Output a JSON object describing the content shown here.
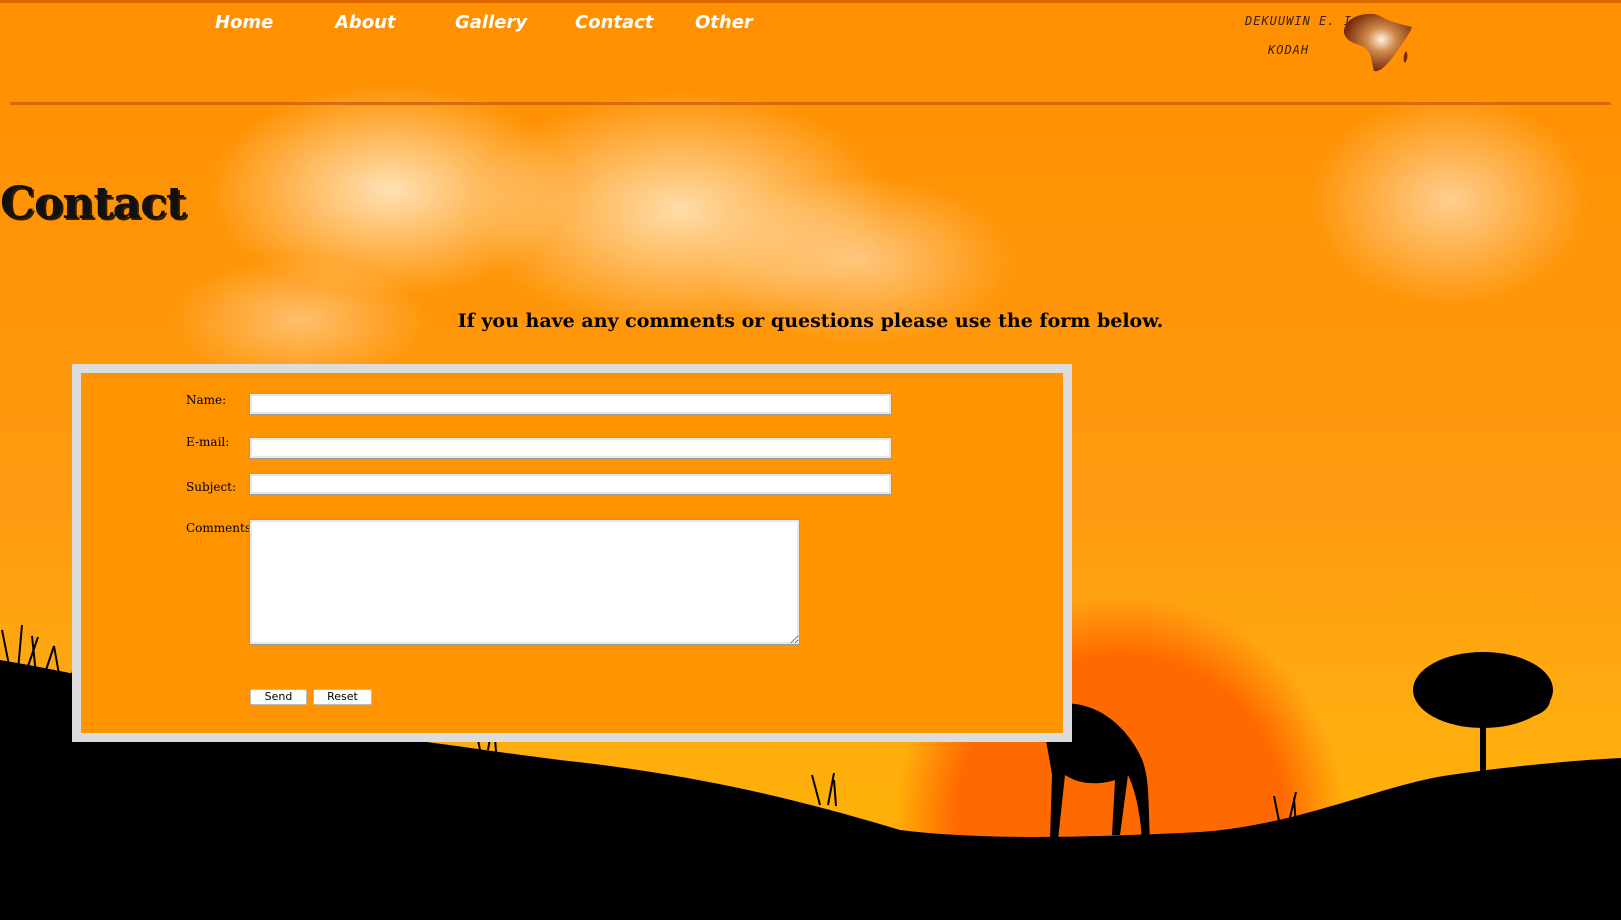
{
  "nav": {
    "items": [
      {
        "label": "Home"
      },
      {
        "label": "About"
      },
      {
        "label": "Gallery"
      },
      {
        "label": "Contact"
      },
      {
        "label": "Other"
      }
    ]
  },
  "author": {
    "line1": "DEKUUWIN  E.  I.",
    "line2": "KODAH"
  },
  "page": {
    "title": "Contact",
    "intro": "If you have any comments or questions please use the form below."
  },
  "form": {
    "name_label": "Name:",
    "name_value": "",
    "email_label": "E-mail:",
    "email_value": "",
    "subject_label": "Subject:",
    "subject_value": "",
    "comments_label": "Comments:",
    "comments_value": "",
    "send_label": "Send",
    "reset_label": "Reset"
  },
  "colors": {
    "sky": "#ff9400",
    "sun": "#ff6a00",
    "form_border": "#dcdcdc",
    "silhouette": "#000000"
  },
  "icons": {
    "logo": "africa-map-icon"
  }
}
